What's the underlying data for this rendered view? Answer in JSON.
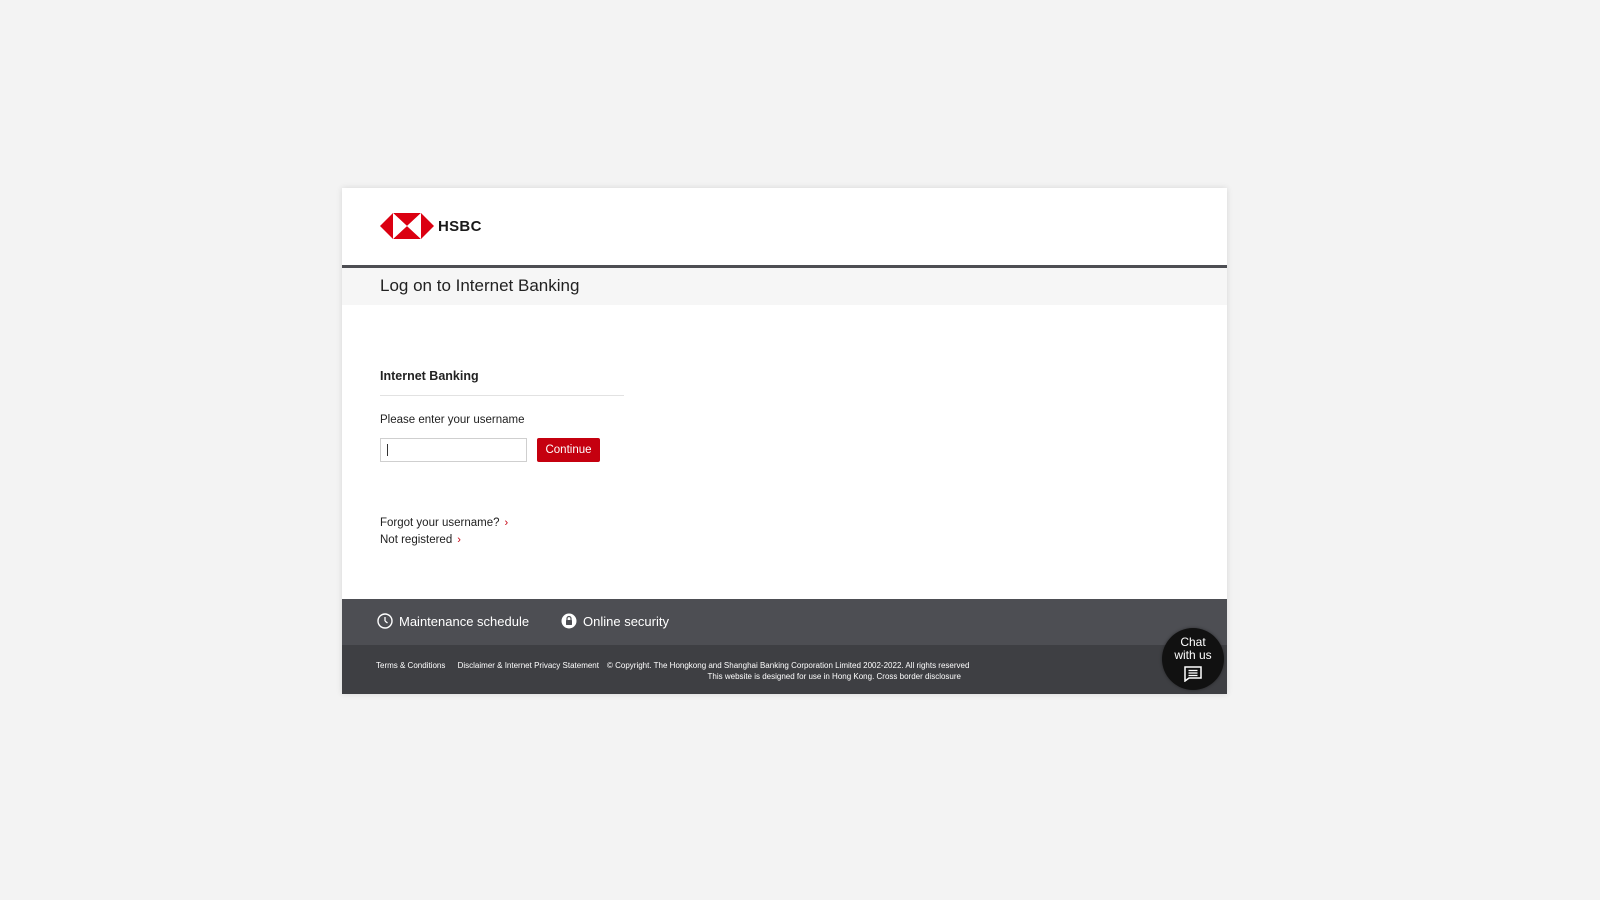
{
  "brand": {
    "name": "HSBC",
    "colors": {
      "red": "#db0011",
      "dark_red": "#c5000f",
      "footer": "#4d4e53"
    }
  },
  "page": {
    "title": "Log on to Internet Banking"
  },
  "login": {
    "section_title": "Internet Banking",
    "username_label": "Please enter your username",
    "username_value": "",
    "continue_label": "Continue"
  },
  "links": {
    "forgot_username": "Forgot your username?",
    "not_registered": "Not registered",
    "chevron": "›"
  },
  "footer": {
    "maintenance": "Maintenance schedule",
    "maintenance_icon": "clock-icon",
    "security": "Online security",
    "security_icon": "lock-icon",
    "terms": "Terms & Conditions",
    "disclaimer": "Disclaimer & Internet Privacy Statement",
    "copyright": "© Copyright. The Hongkong and Shanghai Banking Corporation Limited 2002-2022. All rights reserved",
    "usage_note": "This website is designed for use in Hong Kong. Cross border disclosure"
  },
  "chat": {
    "line1": "Chat",
    "line2": "with us",
    "icon": "chat-icon"
  }
}
